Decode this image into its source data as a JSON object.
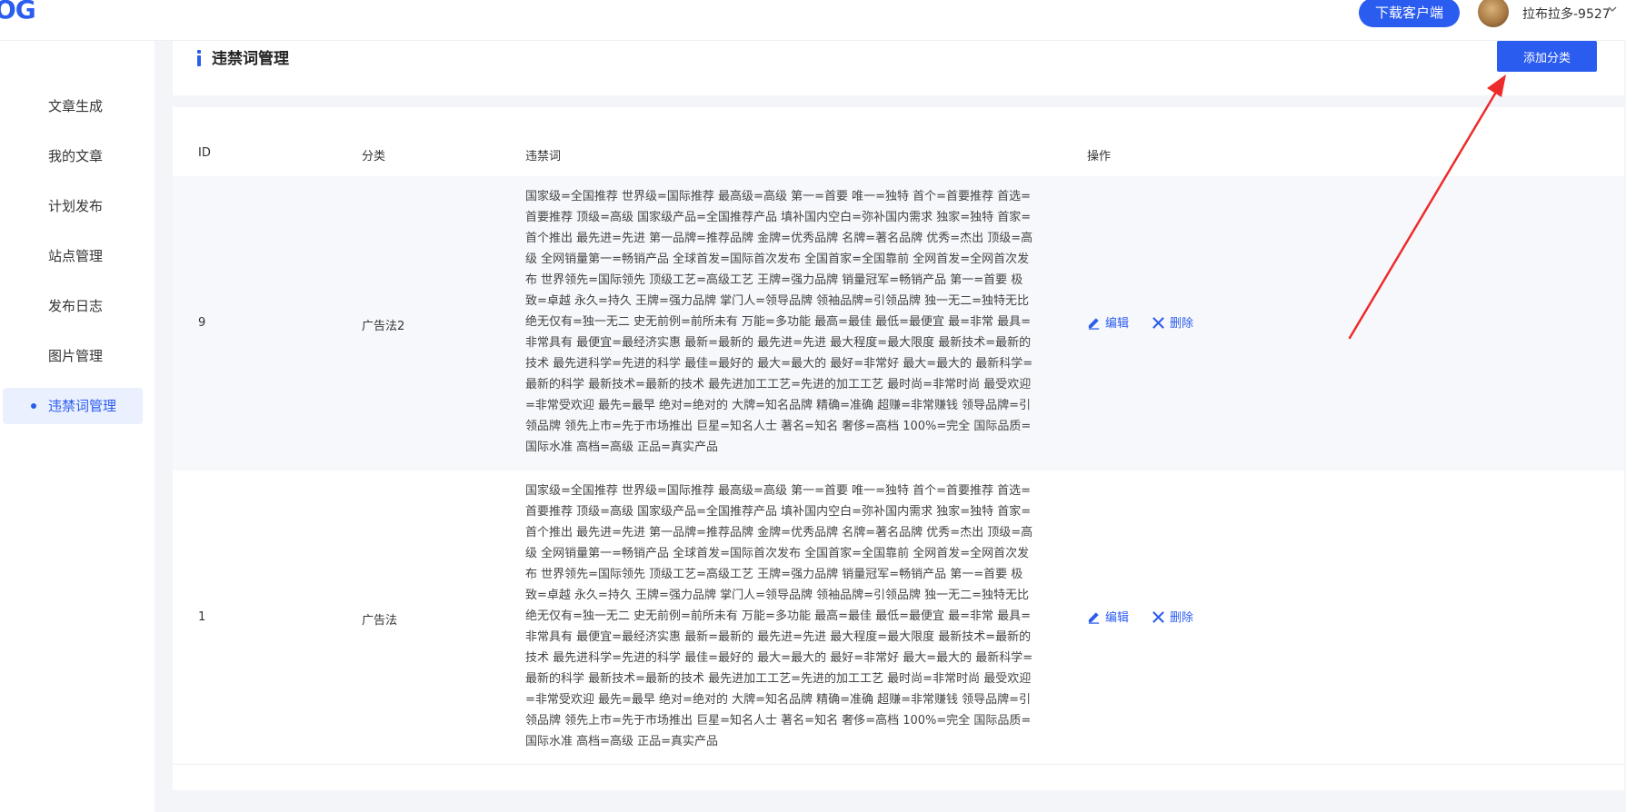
{
  "header": {
    "logo_text": "OG",
    "download_button": "下载客户端",
    "username": "拉布拉多-9527",
    "icons": [
      "avatar",
      "chevron-down-icon"
    ]
  },
  "sidebar": {
    "items": [
      {
        "label": "文章生成",
        "active": false
      },
      {
        "label": "我的文章",
        "active": false
      },
      {
        "label": "计划发布",
        "active": false
      },
      {
        "label": "站点管理",
        "active": false
      },
      {
        "label": "发布日志",
        "active": false
      },
      {
        "label": "图片管理",
        "active": false
      },
      {
        "label": "违禁词管理",
        "active": true
      }
    ]
  },
  "page": {
    "title": "违禁词管理",
    "add_button": "添加分类"
  },
  "table": {
    "columns": [
      "ID",
      "分类",
      "违禁词",
      "操作"
    ],
    "rows": [
      {
        "id": "9",
        "category": "广告法2",
        "words": "国家级=全国推荐 世界级=国际推荐 最高级=高级 第一=首要 唯一=独特 首个=首要推荐 首选=首要推荐 顶级=高级 国家级产品=全国推荐产品 填补国内空白=弥补国内需求 独家=独特 首家=首个推出 最先进=先进 第一品牌=推荐品牌 金牌=优秀品牌 名牌=著名品牌 优秀=杰出 顶级=高级 全网销量第一=畅销产品 全球首发=国际首次发布 全国首家=全国靠前 全网首发=全网首次发布 世界领先=国际领先 顶级工艺=高级工艺 王牌=强力品牌 销量冠军=畅销产品 第一=首要 极致=卓越 永久=持久 王牌=强力品牌 掌门人=领导品牌 领袖品牌=引领品牌 独一无二=独特无比 绝无仅有=独一无二 史无前例=前所未有 万能=多功能 最高=最佳 最低=最便宜 最=非常 最具=非常具有 最便宜=最经济实惠 最新=最新的 最先进=先进 最大程度=最大限度 最新技术=最新的技术 最先进科学=先进的科学 最佳=最好的 最大=最大的 最好=非常好 最大=最大的 最新科学=最新的科学 最新技术=最新的技术 最先进加工工艺=先进的加工工艺 最时尚=非常时尚 最受欢迎=非常受欢迎 最先=最早 绝对=绝对的 大牌=知名品牌 精确=准确 超赚=非常赚钱 领导品牌=引领品牌 领先上市=先于市场推出 巨星=知名人士 著名=知名 奢侈=高档 100%=完全 国际品质=国际水准 高档=高级 正品=真实产品",
        "edit": "编辑",
        "delete": "删除"
      },
      {
        "id": "1",
        "category": "广告法",
        "words": "国家级=全国推荐 世界级=国际推荐 最高级=高级 第一=首要 唯一=独特 首个=首要推荐 首选=首要推荐 顶级=高级 国家级产品=全国推荐产品 填补国内空白=弥补国内需求 独家=独特 首家=首个推出 最先进=先进 第一品牌=推荐品牌 金牌=优秀品牌 名牌=著名品牌 优秀=杰出 顶级=高级 全网销量第一=畅销产品 全球首发=国际首次发布 全国首家=全国靠前 全网首发=全网首次发布 世界领先=国际领先 顶级工艺=高级工艺 王牌=强力品牌 销量冠军=畅销产品 第一=首要 极致=卓越 永久=持久 王牌=强力品牌 掌门人=领导品牌 领袖品牌=引领品牌 独一无二=独特无比 绝无仅有=独一无二 史无前例=前所未有 万能=多功能 最高=最佳 最低=最便宜 最=非常 最具=非常具有 最便宜=最经济实惠 最新=最新的 最先进=先进 最大程度=最大限度 最新技术=最新的技术 最先进科学=先进的科学 最佳=最好的 最大=最大的 最好=非常好 最大=最大的 最新科学=最新的科学 最新技术=最新的技术 最先进加工工艺=先进的加工工艺 最时尚=非常时尚 最受欢迎=非常受欢迎 最先=最早 绝对=绝对的 大牌=知名品牌 精确=准确 超赚=非常赚钱 领导品牌=引领品牌 领先上市=先于市场推出 巨星=知名人士 著名=知名 奢侈=高档 100%=完全 国际品质=国际水准 高档=高级 正品=真实产品",
        "edit": "编辑",
        "delete": "删除"
      }
    ]
  },
  "colors": {
    "accent": "#2b5cf0",
    "annotation_arrow": "#ee2b2b",
    "page_bg": "#f3f5f9",
    "active_nav_bg": "#eaf0fd"
  }
}
